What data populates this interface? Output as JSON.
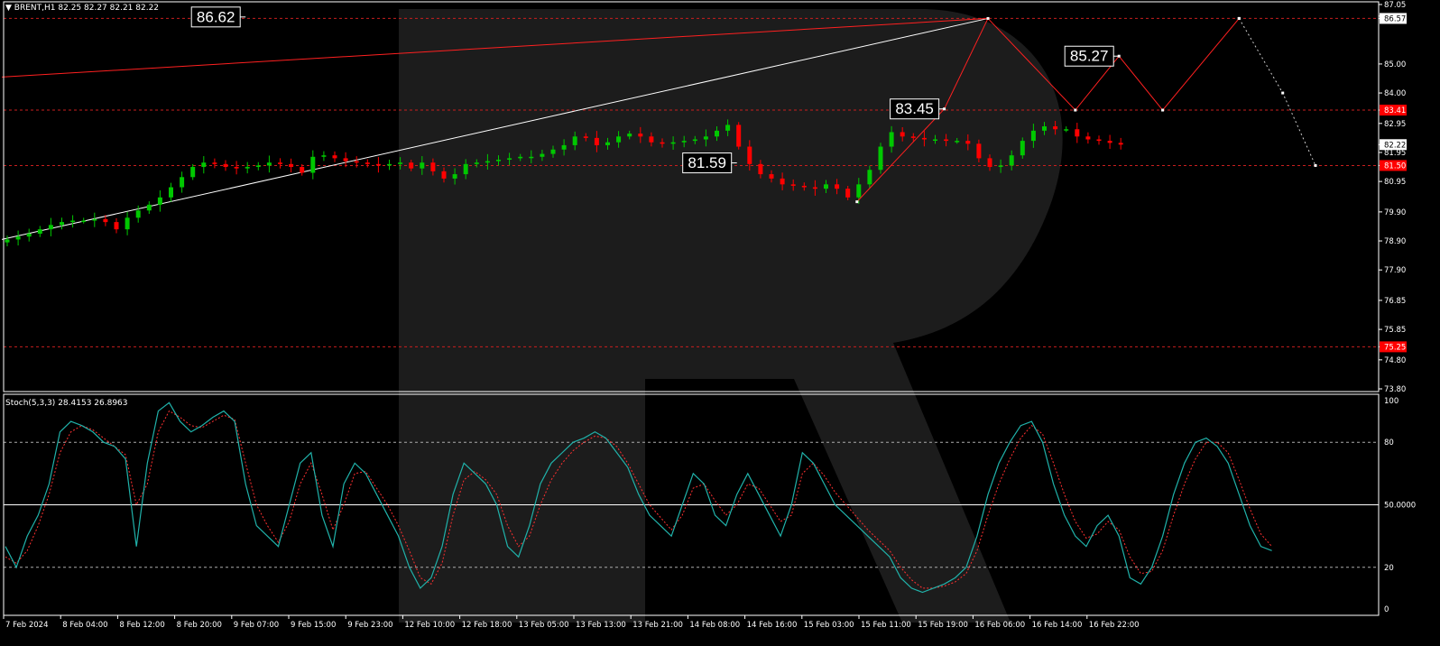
{
  "header": {
    "symbol_label": "BRENT,H1",
    "ohlc": "82.25 82.27 82.21 82.22",
    "indicator_label": "Stoch(5,3,3)",
    "indicator_values": "28.4153 26.8963"
  },
  "colors": {
    "background": "#000000",
    "bull": "#00c800",
    "bear": "#ff0000",
    "grid_level": "#c81e1e",
    "stoch_main": "#20b2aa",
    "stoch_signal": "#ff3030",
    "forecast": "#ff2020",
    "trendline": "#ffffff",
    "watermark": "#1c1c1c"
  },
  "chart_data": [
    {
      "type": "candlestick",
      "title": "",
      "ylim": [
        73.8,
        87.05
      ],
      "y_ticks": [
        "87.05",
        "86.65",
        "86.57",
        "85.00",
        "84.00",
        "83.41",
        "82.95",
        "82.22",
        "81.95",
        "81.50",
        "80.95",
        "79.90",
        "78.90",
        "77.90",
        "76.85",
        "75.85",
        "75.25",
        "74.80",
        "73.80"
      ],
      "x_labels": [
        "7 Feb 2024",
        "8 Feb 04:00",
        "8 Feb 12:00",
        "8 Feb 20:00",
        "9 Feb 07:00",
        "9 Feb 15:00",
        "9 Feb 23:00",
        "12 Feb 10:00",
        "12 Feb 18:00",
        "13 Feb 05:00",
        "13 Feb 13:00",
        "13 Feb 21:00",
        "14 Feb 08:00",
        "14 Feb 16:00",
        "15 Feb 03:00",
        "15 Feb 11:00",
        "15 Feb 19:00",
        "16 Feb 06:00",
        "16 Feb 14:00",
        "16 Feb 22:00"
      ],
      "highlighted_ticks": [
        {
          "label": "86.57",
          "value": 86.57,
          "bg": "#ffffff",
          "fg": "#000000"
        },
        {
          "label": "83.41",
          "value": 83.41,
          "bg": "#ff0000",
          "fg": "#ffffff"
        },
        {
          "label": "82.22",
          "value": 82.22,
          "bg": "#ffffff",
          "fg": "#000000"
        },
        {
          "label": "81.50",
          "value": 81.5,
          "bg": "#ff0000",
          "fg": "#ffffff"
        },
        {
          "label": "75.25",
          "value": 75.25,
          "bg": "#ff0000",
          "fg": "#ffffff"
        }
      ],
      "horizontal_levels": [
        86.57,
        83.41,
        81.5,
        75.25
      ],
      "callouts": [
        {
          "label": "86.62",
          "value": 86.62,
          "bar": 22
        },
        {
          "label": "83.45",
          "value": 83.45,
          "bar": 86
        },
        {
          "label": "81.59",
          "value": 81.59,
          "bar": 67
        },
        {
          "label": "85.27",
          "value": 85.27,
          "bar": 102
        }
      ],
      "close_path": [
        78.95,
        79.05,
        79.15,
        79.3,
        79.45,
        79.55,
        79.6,
        79.6,
        79.65,
        79.55,
        79.3,
        79.7,
        79.95,
        80.15,
        80.4,
        80.75,
        81.1,
        81.45,
        81.6,
        81.55,
        81.45,
        81.4,
        81.45,
        81.5,
        81.6,
        81.55,
        81.45,
        81.25,
        81.8,
        81.85,
        81.75,
        81.65,
        81.6,
        81.55,
        81.5,
        81.55,
        81.6,
        81.4,
        81.6,
        81.3,
        81.05,
        81.2,
        81.55,
        81.6,
        81.65,
        81.7,
        81.75,
        81.8,
        81.8,
        81.9,
        82.05,
        82.2,
        82.5,
        82.45,
        82.2,
        82.3,
        82.5,
        82.6,
        82.5,
        82.3,
        82.25,
        82.3,
        82.35,
        82.4,
        82.5,
        82.7,
        82.9,
        82.15,
        81.55,
        81.2,
        81.05,
        80.85,
        80.8,
        80.75,
        80.7,
        80.85,
        80.7,
        80.4,
        80.85,
        81.35,
        82.15,
        82.65,
        82.5,
        82.45,
        82.4,
        82.4,
        82.35,
        82.35,
        82.25,
        81.75,
        81.45,
        81.5,
        81.85,
        82.35,
        82.7,
        82.85,
        82.75,
        82.75,
        82.5,
        82.4,
        82.35,
        82.28,
        82.22
      ],
      "forecast_path": [
        {
          "bar": 78,
          "value": 80.25
        },
        {
          "bar": 86,
          "value": 83.45
        },
        {
          "bar": 90,
          "value": 86.57
        },
        {
          "bar": 98,
          "value": 83.41
        },
        {
          "bar": 102,
          "value": 85.27
        },
        {
          "bar": 106,
          "value": 83.41
        },
        {
          "bar": 113,
          "value": 86.57
        }
      ],
      "forecast_dotted": [
        {
          "bar": 113,
          "value": 86.57
        },
        {
          "bar": 117,
          "value": 84.0
        },
        {
          "bar": 120,
          "value": 81.5
        }
      ],
      "trendlines": [
        {
          "from": {
            "bar": 0,
            "value": 78.95
          },
          "to": {
            "bar": 90,
            "value": 86.57
          },
          "color": "#ffffff"
        },
        {
          "from": {
            "bar": 0,
            "value": 84.55
          },
          "to": {
            "bar": 90,
            "value": 86.57
          },
          "color": "#ff2020"
        }
      ]
    },
    {
      "type": "line",
      "title": "",
      "ylim": [
        0,
        100
      ],
      "y_ticks": [
        "100",
        "80",
        "50.0000",
        "20",
        "0"
      ],
      "levels": [
        80,
        50,
        20
      ],
      "series": [
        {
          "name": "Main",
          "values": [
            30,
            20,
            35,
            45,
            60,
            85,
            90,
            88,
            85,
            80,
            78,
            72,
            30,
            70,
            95,
            99,
            90,
            85,
            88,
            92,
            95,
            90,
            60,
            40,
            35,
            30,
            50,
            70,
            75,
            45,
            30,
            60,
            70,
            65,
            55,
            45,
            35,
            20,
            10,
            15,
            30,
            55,
            70,
            65,
            60,
            50,
            30,
            25,
            40,
            60,
            70,
            75,
            80,
            82,
            85,
            82,
            75,
            68,
            55,
            45,
            40,
            35,
            50,
            65,
            60,
            45,
            40,
            55,
            65,
            55,
            45,
            35,
            50,
            75,
            70,
            60,
            50,
            45,
            40,
            35,
            30,
            25,
            15,
            10,
            8,
            10,
            12,
            15,
            20,
            35,
            55,
            70,
            80,
            88,
            90,
            80,
            60,
            45,
            35,
            30,
            40,
            45,
            35,
            15,
            12,
            20,
            35,
            55,
            70,
            80,
            82,
            78,
            70,
            55,
            40,
            30,
            28
          ]
        },
        {
          "name": "Signal",
          "values": [
            25,
            22,
            28,
            40,
            55,
            75,
            85,
            88,
            86,
            82,
            78,
            74,
            50,
            60,
            85,
            95,
            92,
            88,
            87,
            90,
            93,
            91,
            70,
            50,
            40,
            32,
            42,
            60,
            70,
            55,
            38,
            50,
            65,
            66,
            58,
            50,
            40,
            28,
            15,
            12,
            22,
            45,
            62,
            66,
            62,
            55,
            40,
            30,
            35,
            50,
            62,
            70,
            76,
            80,
            83,
            82,
            78,
            70,
            60,
            50,
            44,
            38,
            45,
            58,
            60,
            52,
            45,
            50,
            60,
            58,
            50,
            42,
            45,
            65,
            70,
            64,
            56,
            50,
            44,
            38,
            33,
            28,
            20,
            14,
            10,
            10,
            11,
            13,
            17,
            28,
            45,
            60,
            72,
            82,
            88,
            84,
            70,
            55,
            42,
            34,
            36,
            42,
            38,
            25,
            17,
            18,
            28,
            45,
            60,
            72,
            80,
            80,
            75,
            62,
            48,
            36,
            30
          ]
        }
      ]
    }
  ]
}
